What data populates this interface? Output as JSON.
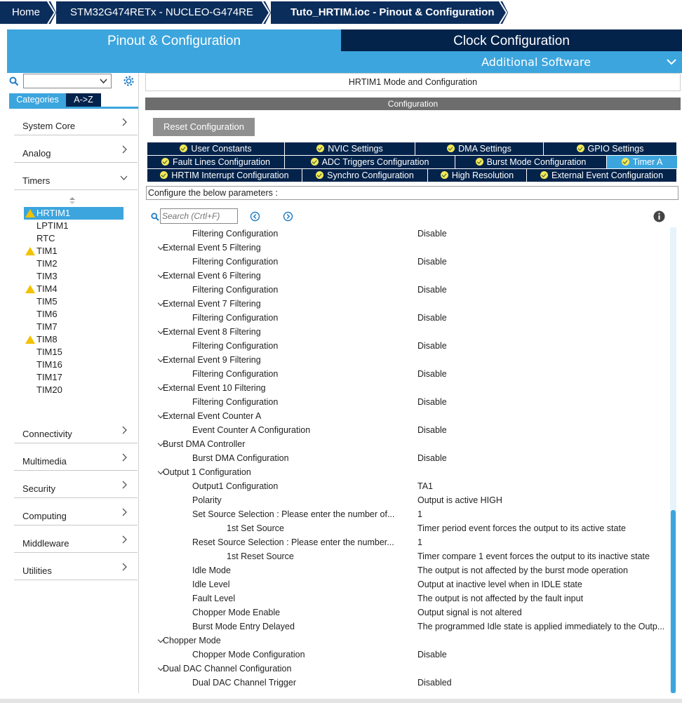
{
  "breadcrumb": {
    "home": "Home",
    "device": "STM32G474RETx  -  NUCLEO-G474RE",
    "project": "Tuto_HRTIM.ioc - Pinout & Configuration"
  },
  "top_tabs": {
    "pinout": "Pinout & Configuration",
    "clock": "Clock Configuration",
    "additional": "Additional Software"
  },
  "left": {
    "tab_categories": "Categories",
    "tab_az": "A->Z",
    "categories": [
      {
        "label": "System Core"
      },
      {
        "label": "Analog"
      },
      {
        "label": "Timers"
      },
      {
        "label": "Connectivity"
      },
      {
        "label": "Multimedia"
      },
      {
        "label": "Security"
      },
      {
        "label": "Computing"
      },
      {
        "label": "Middleware"
      },
      {
        "label": "Utilities"
      }
    ],
    "timers": [
      "HRTIM1",
      "LPTIM1",
      "RTC",
      "TIM1",
      "TIM2",
      "TIM3",
      "TIM4",
      "TIM5",
      "TIM6",
      "TIM7",
      "TIM8",
      "TIM15",
      "TIM16",
      "TIM17",
      "TIM20"
    ],
    "warning_timers": [
      "HRTIM1",
      "TIM1",
      "TIM4",
      "TIM8"
    ],
    "selected_timer": "HRTIM1"
  },
  "right": {
    "mode_title": "HRTIM1 Mode and Configuration",
    "config_title": "Configuration",
    "reset_button": "Reset Configuration",
    "tabs_row1": [
      "User Constants",
      "NVIC Settings",
      "DMA Settings",
      "GPIO Settings"
    ],
    "tabs_row2": [
      "Fault Lines Configuration",
      "ADC Triggers Configuration",
      "Burst Mode Configuration",
      "Timer A"
    ],
    "tabs_row3": [
      "HRTIM Interrupt Configuration",
      "Synchro Configuration",
      "High Resolution",
      "External Event Configuration"
    ],
    "active_tab": "Timer A",
    "configure_label": "Configure the below parameters :",
    "search_placeholder": "Search (Crtl+F)",
    "params": [
      {
        "label": "Filtering Configuration",
        "value": "Disable",
        "level": 2
      },
      {
        "label": "External Event 5 Filtering",
        "value": "",
        "level": 1
      },
      {
        "label": "Filtering Configuration",
        "value": "Disable",
        "level": 2
      },
      {
        "label": "External Event 6 Filtering",
        "value": "",
        "level": 1
      },
      {
        "label": "Filtering Configuration",
        "value": "Disable",
        "level": 2
      },
      {
        "label": "External Event 7 Filtering",
        "value": "",
        "level": 1
      },
      {
        "label": "Filtering Configuration",
        "value": "Disable",
        "level": 2
      },
      {
        "label": "External Event 8 Filtering",
        "value": "",
        "level": 1
      },
      {
        "label": "Filtering Configuration",
        "value": "Disable",
        "level": 2
      },
      {
        "label": "External Event 9 Filtering",
        "value": "",
        "level": 1
      },
      {
        "label": "Filtering Configuration",
        "value": "Disable",
        "level": 2
      },
      {
        "label": "External Event 10 Filtering",
        "value": "",
        "level": 1
      },
      {
        "label": "Filtering Configuration",
        "value": "Disable",
        "level": 2
      },
      {
        "label": "External Event Counter A",
        "value": "",
        "level": 1
      },
      {
        "label": "Event Counter A Configuration",
        "value": "Disable",
        "level": 2
      },
      {
        "label": "Burst DMA Controller",
        "value": "",
        "level": 1
      },
      {
        "label": "Burst DMA Configuration",
        "value": "Disable",
        "level": 2
      },
      {
        "label": "Output 1 Configuration",
        "value": "",
        "level": 1
      },
      {
        "label": "Output1 Configuration",
        "value": "TA1",
        "level": 2
      },
      {
        "label": "Polarity",
        "value": "Output is active HIGH",
        "level": 2
      },
      {
        "label": "Set Source  Selection : Please enter the number of...",
        "value": "1",
        "level": 2
      },
      {
        "label": "1st Set Source",
        "value": "Timer period event forces the output to its active state",
        "level": 3
      },
      {
        "label": "Reset Source  Selection : Please enter the number...",
        "value": "1",
        "level": 2
      },
      {
        "label": "1st Reset Source",
        "value": "Timer compare 1 event forces the output to its inactive state",
        "level": 3
      },
      {
        "label": "Idle Mode",
        "value": "The output is not affected by the burst mode operation",
        "level": 2
      },
      {
        "label": "Idle Level",
        "value": "Output at inactive level when in IDLE state",
        "level": 2
      },
      {
        "label": "Fault Level",
        "value": "The output is not affected by the fault input",
        "level": 2
      },
      {
        "label": "Chopper Mode Enable",
        "value": "Output signal is not altered",
        "level": 2
      },
      {
        "label": "Burst Mode Entry Delayed",
        "value": "The programmed Idle state is applied immediately to the Outp...",
        "level": 2
      },
      {
        "label": "Chopper Mode",
        "value": "",
        "level": 1
      },
      {
        "label": "Chopper Mode Configuration",
        "value": "Disable",
        "level": 2
      },
      {
        "label": "Dual DAC Channel Configuration",
        "value": "",
        "level": 1
      },
      {
        "label": "Dual DAC Channel Trigger",
        "value": "Disabled",
        "level": 2
      }
    ]
  },
  "colors": {
    "navy": "#03234b",
    "accent": "#3ca5dd",
    "warning": "#f2c200",
    "header_grey": "#6d6d6d"
  }
}
